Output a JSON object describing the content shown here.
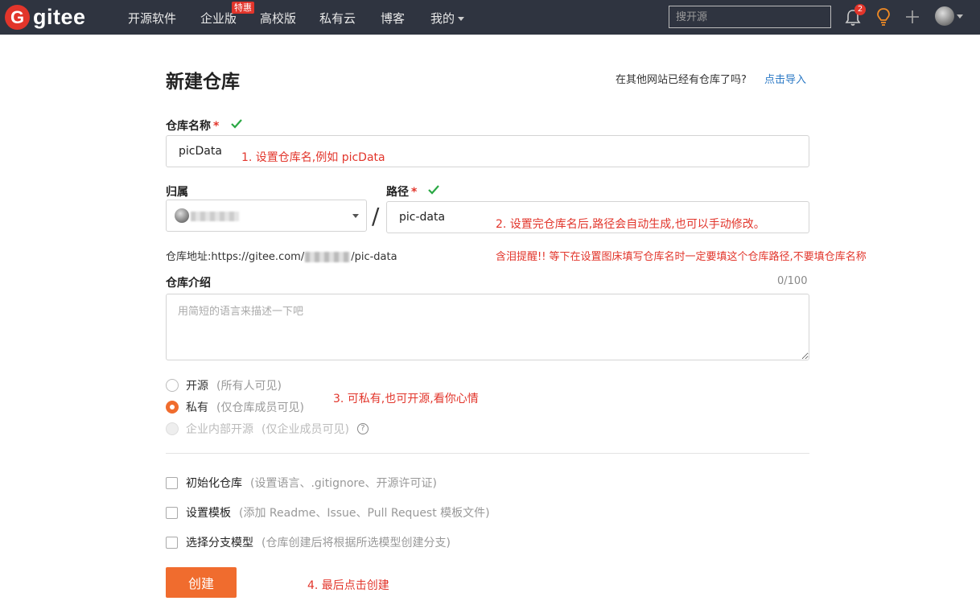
{
  "nav": {
    "logo_letter": "G",
    "logo_text": "gitee",
    "links": [
      "开源软件",
      "企业版",
      "高校版",
      "私有云",
      "博客",
      "我的"
    ],
    "promo_badge": "特惠",
    "search_placeholder": "搜开源",
    "notification_count": "2"
  },
  "form": {
    "title": "新建仓库",
    "import_question": "在其他网站已经有仓库了吗?",
    "import_link": "点击导入",
    "repo_name_label": "仓库名称",
    "required_mark": "*",
    "repo_name_value": "picData",
    "owner_label": "归属",
    "path_label": "路径",
    "path_value": "pic-data",
    "slash": "/",
    "address_prefix": "仓库地址:https://gitee.com/",
    "address_suffix": "/pic-data",
    "description_label": "仓库介绍",
    "description_counter": "0/100",
    "description_placeholder": "用简短的语言来描述一下吧",
    "visibility": [
      {
        "label": "开源",
        "hint": "(所有人可见)",
        "state": "unchecked"
      },
      {
        "label": "私有",
        "hint": "(仅仓库成员可见)",
        "state": "checked"
      },
      {
        "label": "企业内部开源",
        "hint": "(仅企业成员可见)",
        "state": "disabled"
      }
    ],
    "options": [
      {
        "label": "初始化仓库",
        "hint": "(设置语言、.gitignore、开源许可证)"
      },
      {
        "label": "设置模板",
        "hint": "(添加 Readme、Issue、Pull Request 模板文件)"
      },
      {
        "label": "选择分支模型",
        "hint": "(仓库创建后将根据所选模型创建分支)"
      }
    ],
    "create_button": "创建"
  },
  "annotations": {
    "note1": "1. 设置仓库名,例如 picData",
    "note2": "2. 设置完仓库名后,路径会自动生成,也可以手动修改。",
    "note_warning": "含泪提醒!! 等下在设置图床填写仓库名时一定要填这个仓库路径,不要填仓库名称",
    "note3": "3. 可私有,也可开源,看你心情",
    "note4": "4. 最后点击创建"
  },
  "colors": {
    "nav_bg": "#2f3440",
    "brand_red": "#e2352b",
    "accent_orange": "#f06c2e",
    "link_blue": "#2a78c5",
    "annotation_red": "#e2352b",
    "valid_green": "#2aa844"
  }
}
